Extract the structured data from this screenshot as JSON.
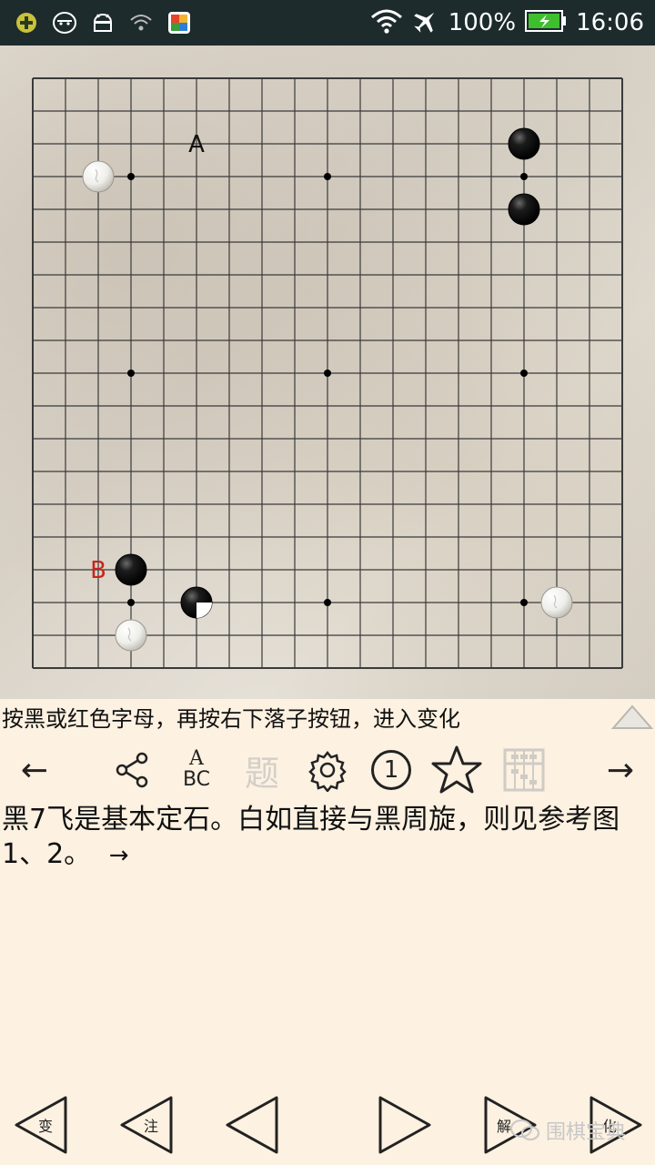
{
  "status_bar": {
    "battery": "100%",
    "time": "16:06",
    "left_icons": [
      "plus-badge-icon",
      "face-icon",
      "android-icon",
      "wifi-question-icon",
      "colorful-app-icon"
    ],
    "right_icons": [
      "wifi-icon",
      "airplane-icon",
      "battery-icon"
    ]
  },
  "board": {
    "size": 19,
    "stones": [
      {
        "col": 2,
        "row": 3,
        "color": "white",
        "name": "white-stone"
      },
      {
        "col": 15,
        "row": 2,
        "color": "black",
        "name": "black-stone"
      },
      {
        "col": 15,
        "row": 4,
        "color": "black",
        "name": "black-stone"
      },
      {
        "col": 3,
        "row": 15,
        "color": "black",
        "name": "black-stone"
      },
      {
        "col": 5,
        "row": 16,
        "color": "black-last",
        "name": "last-move-black-stone"
      },
      {
        "col": 3,
        "row": 17,
        "color": "white",
        "name": "white-stone"
      },
      {
        "col": 16,
        "row": 16,
        "color": "white",
        "name": "white-stone"
      }
    ],
    "labels": [
      {
        "col": 5,
        "row": 2,
        "text": "A",
        "color": "#111111"
      },
      {
        "col": 2,
        "row": 15,
        "text": "B",
        "color": "#c8241c"
      }
    ],
    "star_points": [
      [
        3,
        3
      ],
      [
        9,
        3
      ],
      [
        15,
        3
      ],
      [
        3,
        9
      ],
      [
        9,
        9
      ],
      [
        15,
        9
      ],
      [
        3,
        16
      ],
      [
        9,
        16
      ],
      [
        15,
        16
      ]
    ]
  },
  "instruction": "按黑或红色字母，再按右下落子按钮，进入变化",
  "toolbar": {
    "prev_arrow": "←",
    "next_arrow": "→",
    "abc_top": "A",
    "abc_bottom": "BC",
    "problem_label": "题",
    "move_number": "1"
  },
  "commentary": {
    "text": "黑7飞是基本定石。白如直接与黑周旋，则见参考图1、2。",
    "arrow": "→"
  },
  "bottom_nav": {
    "variation": "变",
    "note": "注",
    "solution": "解",
    "change": "化"
  },
  "watermark": "围棋宝典",
  "colors": {
    "status_bar_bg": "#1d2b2d",
    "page_bg": "#fdf1e1",
    "label_red": "#c8241c",
    "battery_green": "#3fbf2e"
  }
}
